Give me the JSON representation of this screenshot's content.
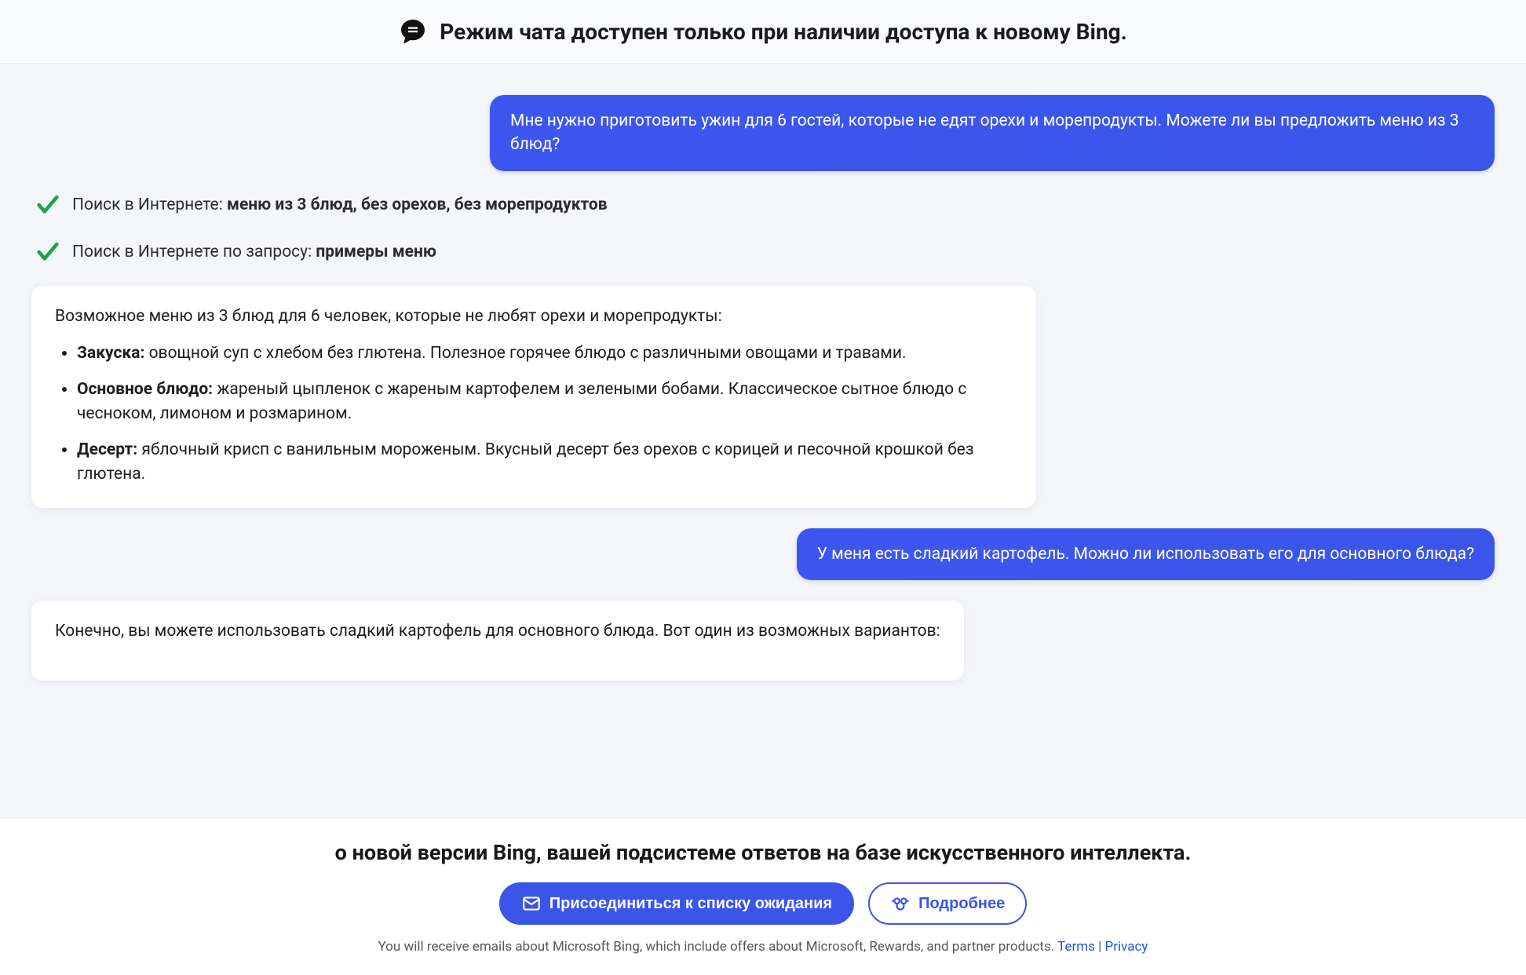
{
  "topbar": {
    "title": "Режим чата доступен только при наличии доступа к новому Bing."
  },
  "chat": {
    "user_msg_1": "Мне нужно приготовить ужин для 6 гостей, которые не едят орехи и морепродукты. Можете ли вы предложить меню из 3 блюд?",
    "search_steps": [
      {
        "prefix": "Поиск в Интернете: ",
        "bold": "меню из 3 блюд, без орехов, без морепродуктов"
      },
      {
        "prefix": "Поиск в Интернете по запросу: ",
        "bold": "примеры меню"
      }
    ],
    "ai_msg_1": {
      "intro": "Возможное меню из 3 блюд для 6 человек, которые не любят орехи и морепродукты:",
      "items": [
        {
          "label": "Закуска:",
          "body": " овощной суп с хлебом без глютена. Полезное горячее блюдо с различными овощами и травами."
        },
        {
          "label": "Основное блюдо:",
          "body": " жареный цыпленок с жареным картофелем и зелеными бобами. Классическое сытное блюдо с чесноком, лимоном и розмарином."
        },
        {
          "label": "Десерт:",
          "body": " яблочный крисп с ванильным мороженым. Вкусный десерт без орехов с корицей и песочной крошкой без глютена."
        }
      ]
    },
    "user_msg_2": "У меня есть сладкий картофель. Можно ли использовать его для основного блюда?",
    "ai_msg_2_intro": "Конечно, вы можете использовать сладкий картофель для основного блюда. Вот один из возможных вариантов:"
  },
  "footer": {
    "heading": "о новой версии Bing, вашей подсистеме ответов на базе искусственного интеллекта.",
    "cta_primary": "Присоединиться к списку ожидания",
    "cta_secondary": "Подробнее",
    "disclaimer_text": "You will receive emails about Microsoft Bing, which include offers about Microsoft, Rewards, and partner products. ",
    "link_terms": "Terms",
    "sep": " | ",
    "link_privacy": "Privacy"
  }
}
